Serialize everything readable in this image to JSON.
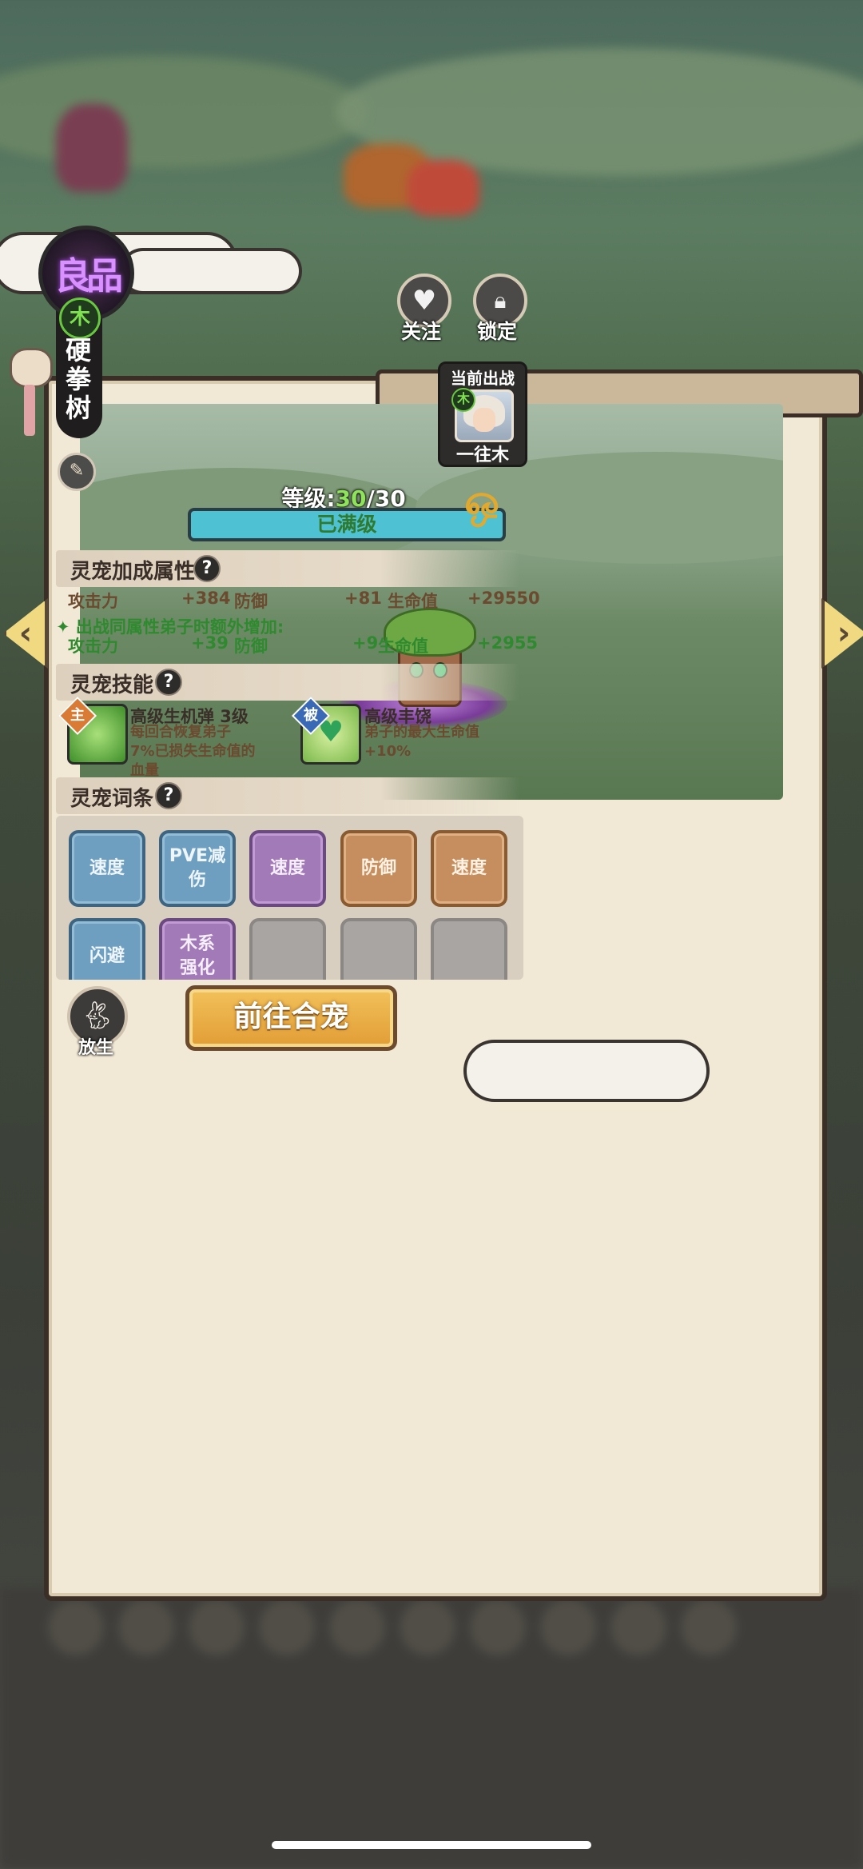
{
  "pet": {
    "quality": "良品",
    "element": "木",
    "name": "硬拳树",
    "level_label": "等级:",
    "level_current": "30",
    "level_max": "/30",
    "max_text": "已满级"
  },
  "actions": {
    "follow_label": "关注",
    "lock_label": "锁定",
    "release_label": "放生",
    "merge_label": "前往合宠"
  },
  "current_battle": {
    "title": "当前出战",
    "element": "木",
    "name": "一往木"
  },
  "bonus": {
    "title": "灵宠加成属性",
    "help": "?",
    "stats": [
      {
        "label": "攻击力",
        "value": "+384"
      },
      {
        "label": "防御",
        "value": "+81"
      },
      {
        "label": "生命值",
        "value": "+29550"
      }
    ],
    "extra_title": "出战同属性弟子时额外增加:",
    "extra_stats": [
      {
        "label": "攻击力",
        "value": "+39"
      },
      {
        "label": "防御",
        "value": "+9"
      },
      {
        "label": "生命值",
        "value": "+2955"
      }
    ]
  },
  "skills": {
    "title": "灵宠技能",
    "help": "?",
    "items": [
      {
        "tag": "主",
        "name": "高级生机弹 3级",
        "desc_lines": [
          "每回合恢复弟子",
          "7%已损失生命值的",
          "血量"
        ]
      },
      {
        "tag": "被",
        "name": "高级丰饶",
        "desc_lines": [
          "弟子的最大生命值",
          "+10%"
        ]
      }
    ]
  },
  "traits": {
    "title": "灵宠词条",
    "help": "?",
    "items": [
      {
        "label": "速度",
        "color": "blue"
      },
      {
        "label": "PVE减\n伤",
        "color": "blue"
      },
      {
        "label": "速度",
        "color": "purple"
      },
      {
        "label": "防御",
        "color": "orange"
      },
      {
        "label": "速度",
        "color": "orange"
      },
      {
        "label": "闪避",
        "color": "blue"
      },
      {
        "label": "木系\n强化",
        "color": "purple"
      }
    ]
  },
  "colors": {
    "accent": "#e29d36",
    "panel": "#f1e8d6",
    "quality_purple": "#d891ff",
    "element_green": "#7ee04f"
  }
}
